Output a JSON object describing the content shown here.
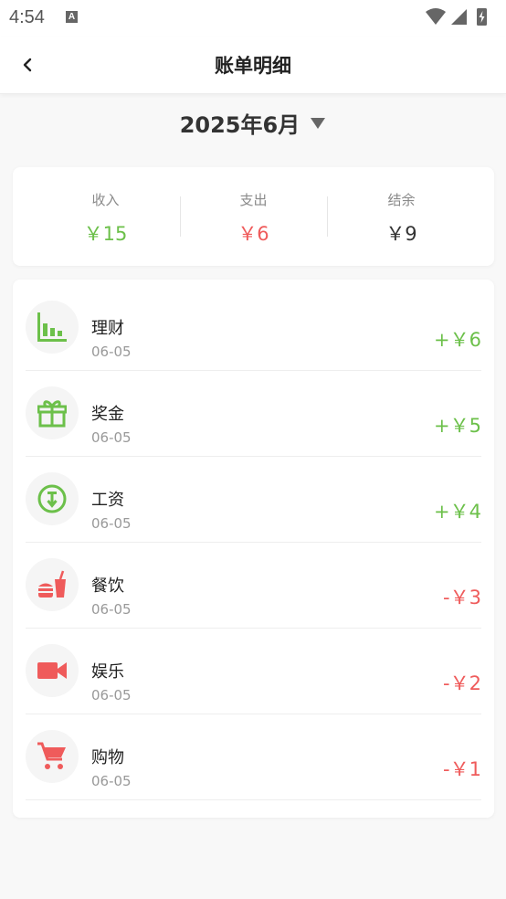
{
  "status_bar": {
    "time": "4:54",
    "notif": "A"
  },
  "header": {
    "title": "账单明细"
  },
  "month": {
    "label": "2025年6月"
  },
  "summary": {
    "income_label": "收入",
    "income_value": "￥15",
    "expense_label": "支出",
    "expense_value": "￥6",
    "balance_label": "结余",
    "balance_value": "￥9"
  },
  "colors": {
    "income": "#6cc04a",
    "expense": "#ef5b5b"
  },
  "transactions": [
    {
      "name": "理财",
      "date": "06-05",
      "amount": "+￥6",
      "icon": "bar-chart-icon",
      "type": "income"
    },
    {
      "name": "奖金",
      "date": "06-05",
      "amount": "+￥5",
      "icon": "gift-icon",
      "type": "income"
    },
    {
      "name": "工资",
      "date": "06-05",
      "amount": "+￥4",
      "icon": "salary-icon",
      "type": "income"
    },
    {
      "name": "餐饮",
      "date": "06-05",
      "amount": "-￥3",
      "icon": "food-drink-icon",
      "type": "expense"
    },
    {
      "name": "娱乐",
      "date": "06-05",
      "amount": "-￥2",
      "icon": "video-camera-icon",
      "type": "expense"
    },
    {
      "name": "购物",
      "date": "06-05",
      "amount": "-￥1",
      "icon": "shopping-cart-icon",
      "type": "expense"
    }
  ]
}
